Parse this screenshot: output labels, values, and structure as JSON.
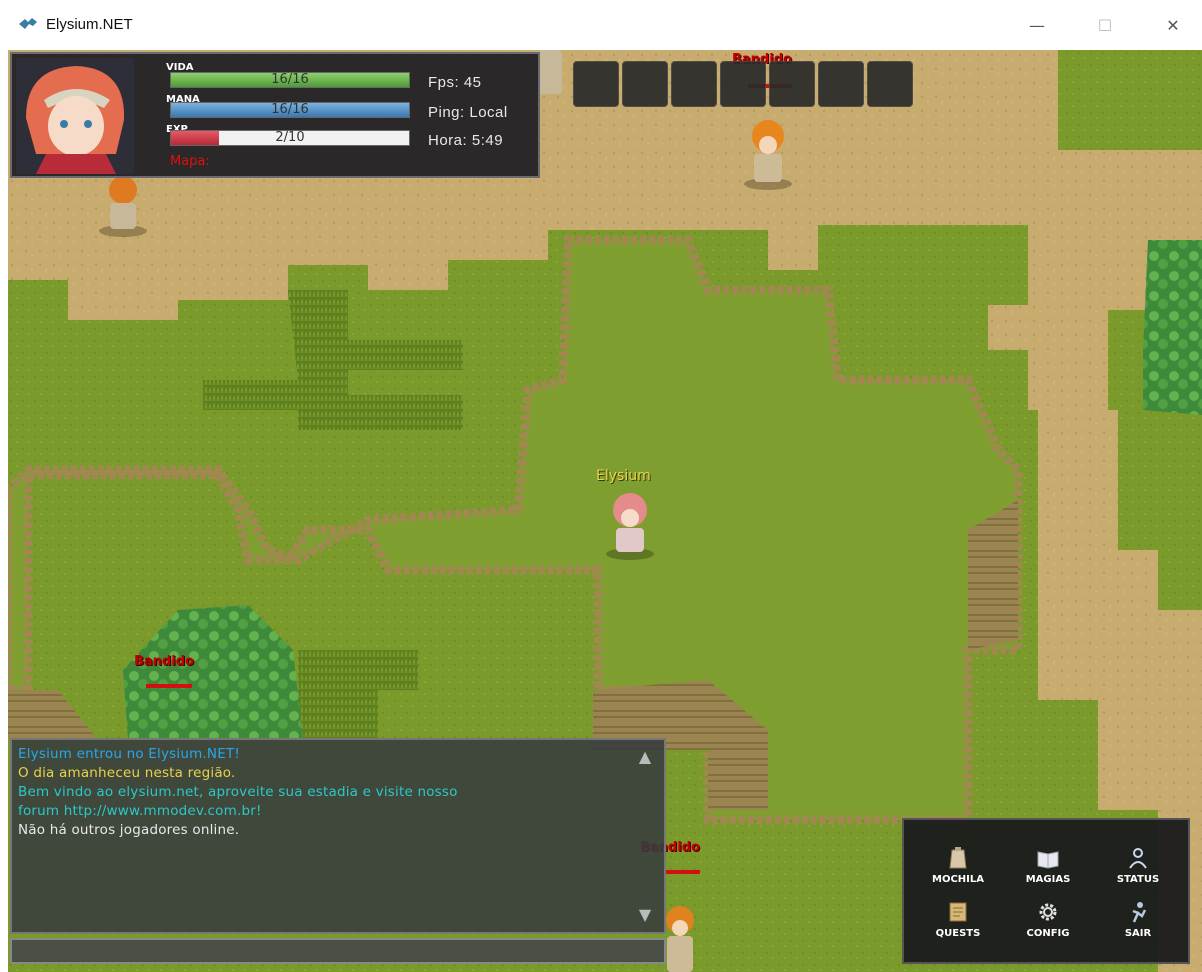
{
  "window": {
    "title": "Elysium.NET",
    "icon": "game-logo-icon",
    "controls": {
      "minimize": "—",
      "maximize": "☐",
      "close": "✕"
    }
  },
  "hud": {
    "vida_label": "VIDA",
    "vida_value": "16/16",
    "vida_fraction": 1.0,
    "mana_label": "MANA",
    "mana_value": "16/16",
    "mana_fraction": 1.0,
    "exp_label": "EXP",
    "exp_value": "2/10",
    "exp_fraction": 0.2,
    "map_label": "Mapa:",
    "fps": "Fps: 45",
    "ping": "Ping: Local",
    "time": "Hora: 5:49",
    "colors": {
      "vida": "#6fc053",
      "mana": "#4a8ec8",
      "exp": "#d33a4a"
    }
  },
  "hotbar": {
    "slot_count": 7
  },
  "characters": {
    "player_name": "Elysium",
    "npc_name": "Bandido"
  },
  "chat": {
    "lines": [
      {
        "text": "Elysium entrou no Elysium.NET!",
        "color": "#2aa6e8"
      },
      {
        "text": "O dia amanheceu nesta região.",
        "color": "#e8d24a"
      },
      {
        "text": "Bem vindo ao elysium.net, aproveite sua estadia e visite nosso",
        "color": "#2cc8c8"
      },
      {
        "text": "forum http://www.mmodev.com.br!",
        "color": "#2cc8c8"
      },
      {
        "text": "Não há outros jogadores online.",
        "color": "#e8e8e8"
      }
    ],
    "input_value": ""
  },
  "menu": {
    "items": [
      {
        "label": "MOCHILA",
        "icon": "backpack-icon"
      },
      {
        "label": "MAGIAS",
        "icon": "spellbook-icon"
      },
      {
        "label": "STATUS",
        "icon": "status-icon"
      },
      {
        "label": "QUESTS",
        "icon": "scroll-icon"
      },
      {
        "label": "CONFIG",
        "icon": "gear-icon"
      },
      {
        "label": "SAIR",
        "icon": "exit-icon"
      }
    ]
  }
}
